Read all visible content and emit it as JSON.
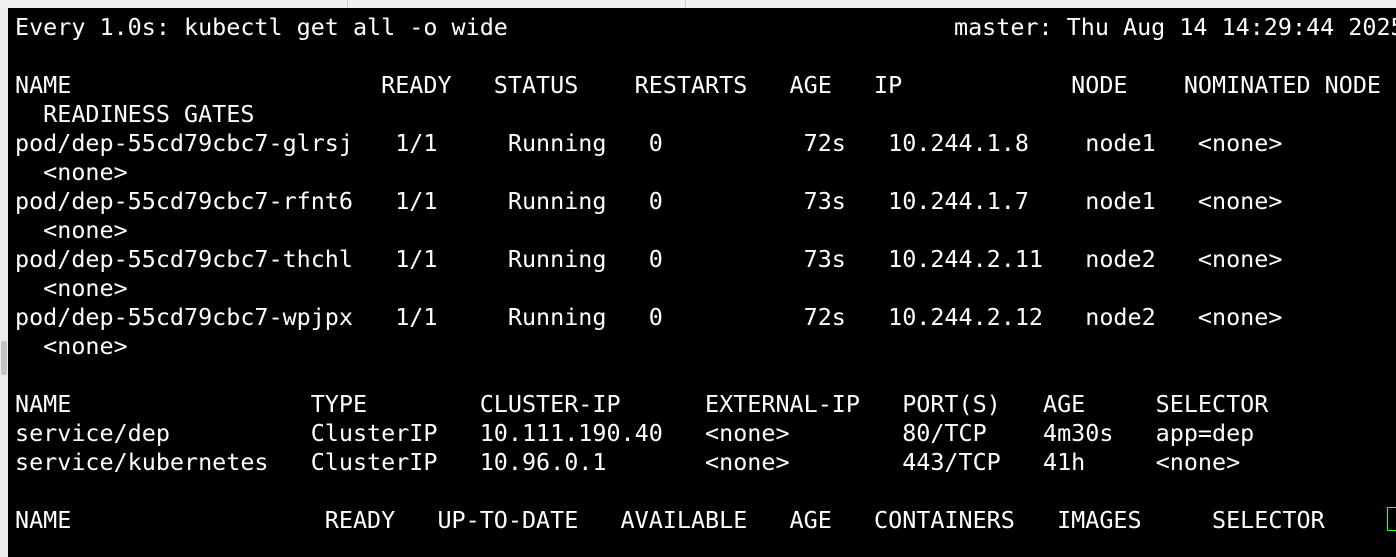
{
  "watch": {
    "header_left": "Every 1.0s: kubectl get all -o wide",
    "header_right": "master: Thu Aug 14 14:29:44 2025"
  },
  "pods": {
    "header": "NAME                      READY   STATUS    RESTARTS   AGE   IP            NODE    NOMINATED NODE",
    "header_wrap": "  READINESS GATES",
    "rows": [
      {
        "line": "pod/dep-55cd79cbc7-glrsj   1/1     Running   0          72s   10.244.1.8    node1   <none>",
        "wrap": "  <none>"
      },
      {
        "line": "pod/dep-55cd79cbc7-rfnt6   1/1     Running   0          73s   10.244.1.7    node1   <none>",
        "wrap": "  <none>"
      },
      {
        "line": "pod/dep-55cd79cbc7-thchl   1/1     Running   0          73s   10.244.2.11   node2   <none>",
        "wrap": "  <none>"
      },
      {
        "line": "pod/dep-55cd79cbc7-wpjpx   1/1     Running   0          72s   10.244.2.12   node2   <none>",
        "wrap": "  <none>"
      }
    ]
  },
  "services": {
    "header": "NAME                 TYPE        CLUSTER-IP      EXTERNAL-IP   PORT(S)   AGE     SELECTOR",
    "rows": [
      "service/dep          ClusterIP   10.111.190.40   <none>        80/TCP    4m30s   app=dep",
      "service/kubernetes   ClusterIP   10.96.0.1       <none>        443/TCP   41h     <none>"
    ]
  },
  "deployments": {
    "header": "NAME                  READY   UP-TO-DATE   AVAILABLE   AGE   CONTAINERS   IMAGES     SELECTOR"
  },
  "colors": {
    "background": "#000000",
    "foreground": "#ffffff",
    "cursor": "#39ff39"
  }
}
